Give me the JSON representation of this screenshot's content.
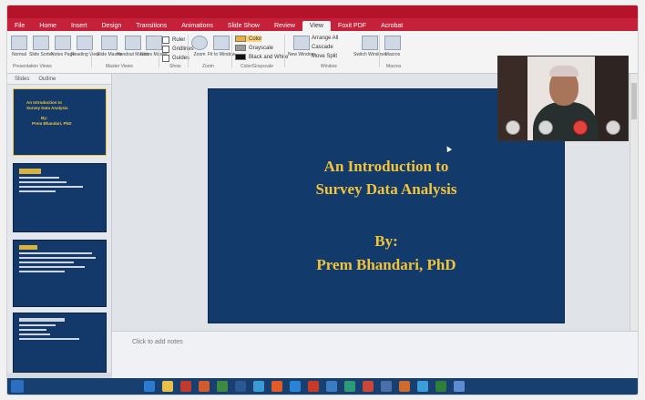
{
  "ribbon": {
    "tabs": [
      "File",
      "Home",
      "Insert",
      "Design",
      "Transitions",
      "Animations",
      "Slide Show",
      "Review",
      "View",
      "Foxit PDF",
      "Acrobat"
    ],
    "active_tab": "View",
    "buttons": {
      "normal": "Normal",
      "slide_sorter": "Slide Sorter",
      "notes_page": "Notes Page",
      "reading_view": "Reading View",
      "slide_master": "Slide Master",
      "handout_master": "Handout Master",
      "notes_master": "Notes Master",
      "zoom": "Zoom",
      "fit_to_window": "Fit to Window",
      "new_window": "New Window",
      "switch_windows": "Switch Windows",
      "macros": "Macros"
    },
    "show": {
      "ruler": "Ruler",
      "gridlines": "Gridlines",
      "guides": "Guides"
    },
    "color_modes": {
      "color": "Color",
      "grayscale": "Grayscale",
      "black_white": "Black and White"
    },
    "window_opts": {
      "arrange_all": "Arrange All",
      "cascade": "Cascade",
      "move_split": "Move Split"
    },
    "groups": {
      "presentation_views": "Presentation Views",
      "master_views": "Master Views",
      "show": "Show",
      "zoom": "Zoom",
      "color_grayscale": "Color/Grayscale",
      "window": "Window",
      "macros": "Macros"
    }
  },
  "panel": {
    "tabs": [
      "Slides",
      "Outline"
    ],
    "thumb1": {
      "l1": "An Introduction to",
      "l2": "Survey Data Analysis",
      "l3": "By:",
      "l4": "Prem Bhandari, PhD"
    }
  },
  "slide": {
    "title_line1": "An Introduction to",
    "title_line2": "Survey Data Analysis",
    "by_label": "By:",
    "author": "Prem Bhandari, PhD"
  },
  "notes": {
    "placeholder": "Click to add notes"
  }
}
